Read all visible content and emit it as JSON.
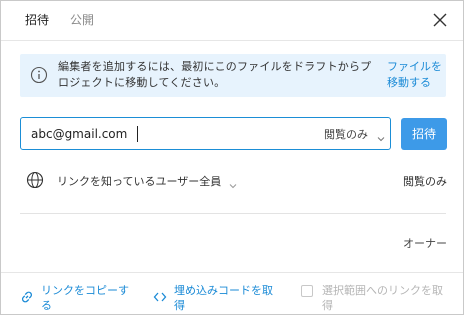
{
  "tabs": [
    {
      "label": "招待"
    },
    {
      "label": "公開"
    }
  ],
  "banner": {
    "text": "編集者を追加するには、最初にこのファイルをドラフトからプロジェクトに移動してください。",
    "link": "ファイルを移動する"
  },
  "email": {
    "value": "abc@gmail.com",
    "permission": "閲覧のみ"
  },
  "invite_button": "招待",
  "link_sharing": {
    "label": "リンクを知っているユーザー全員",
    "permission": "閲覧のみ"
  },
  "owner_role": "オーナー",
  "footer": {
    "copy_link": "リンクをコピーする",
    "embed_code": "埋め込みコードを取得",
    "selection_link": "選択範囲へのリンクを取得"
  },
  "colors": {
    "accent": "#3d9ae8",
    "link": "#1a8ad6",
    "banner_bg": "#e7f3fd"
  }
}
